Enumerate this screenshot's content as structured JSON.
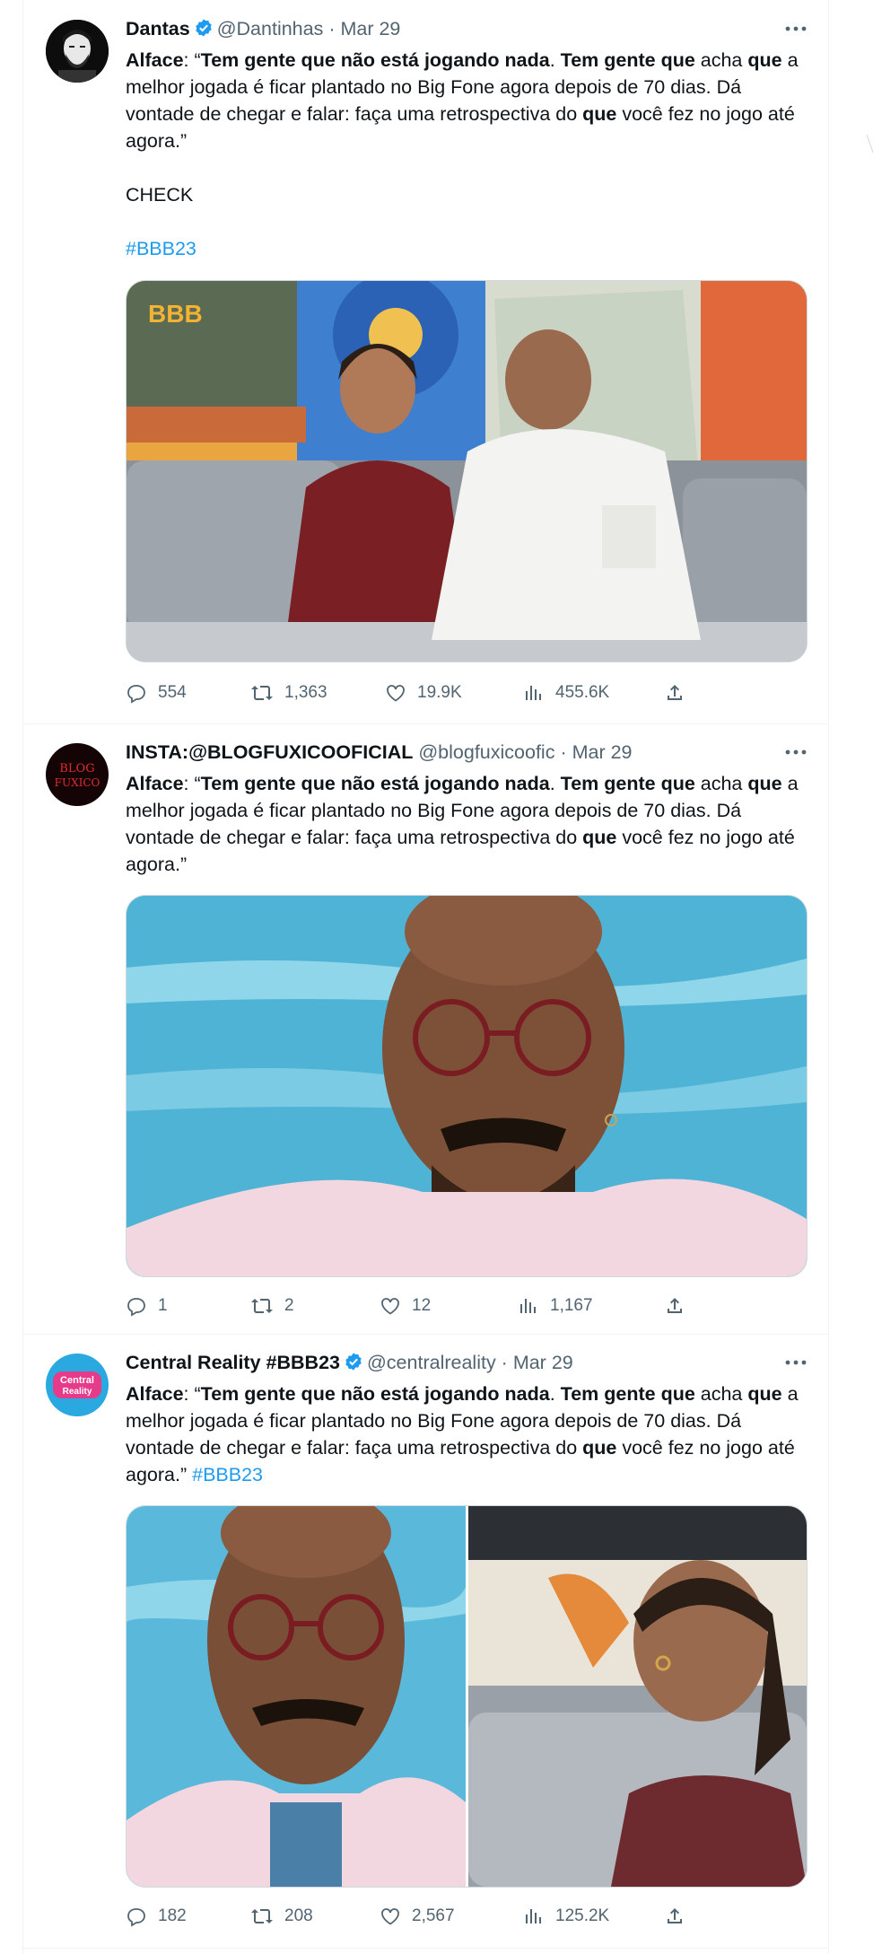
{
  "tweets": [
    {
      "name": "Dantas",
      "verified": true,
      "handle": "@Dantinhas",
      "date": "Mar 29",
      "text": {
        "p1": "Alface",
        "p2": ": “",
        "p3": "Tem gente que não está jogando nada",
        "p4": ". ",
        "p5": "Tem gente que",
        "p6": " acha ",
        "p7": "que",
        "p8": " a melhor jogada é ficar plantado no Big Fone agora depois de 70 dias. Dá vontade de chegar e falar: faça uma retrospectiva do ",
        "p9": "que",
        "p10": " você fez no jogo até agora.”"
      },
      "extra_line": "CHECK",
      "hashtag": "#BBB23",
      "media_logo": "BBB",
      "stats": {
        "replies": "554",
        "retweets": "1,363",
        "likes": "19.9K",
        "views": "455.6K"
      }
    },
    {
      "name": "INSTA:@BLOGFUXICOOFICIAL",
      "verified": false,
      "handle": "@blogfuxicoofic",
      "date": "Mar 29",
      "avatar_text": [
        "BLOG",
        "FUXICO"
      ],
      "text": {
        "p1": "Alface",
        "p2": ": “",
        "p3": "Tem gente que não está jogando nada",
        "p4": ". ",
        "p5": "Tem gente que",
        "p6": " acha ",
        "p7": "que",
        "p8": " a melhor jogada é ficar plantado no Big Fone agora depois de 70 dias. Dá vontade de chegar e falar: faça uma retrospectiva do ",
        "p9": "que",
        "p10": " você fez no jogo até agora.”"
      },
      "stats": {
        "replies": "1",
        "retweets": "2",
        "likes": "12",
        "views": "1,167"
      }
    },
    {
      "name": "Central Reality #BBB23",
      "verified": true,
      "handle": "@centralreality",
      "date": "Mar 29",
      "avatar_text": [
        "Central",
        "Reality"
      ],
      "text": {
        "p1": "Alface",
        "p2": ": “",
        "p3": "Tem gente que não está jogando nada",
        "p4": ". ",
        "p5": "Tem gente que",
        "p6": " acha ",
        "p7": "que",
        "p8": " a melhor jogada é ficar plantado no Big Fone agora depois de 70 dias. Dá vontade de chegar e falar: faça uma retrospectiva do ",
        "p9": "que",
        "p10": " você fez no jogo até agora.” "
      },
      "hashtag": "#BBB23",
      "stats": {
        "replies": "182",
        "retweets": "208",
        "likes": "2,567",
        "views": "125.2K"
      }
    }
  ],
  "colors": {
    "verified": "#1d9bf0",
    "link": "#1d9bf0",
    "muted": "#536471",
    "border": "#eff3f4"
  },
  "icons": [
    "verified-badge-icon",
    "more-icon",
    "reply-icon",
    "retweet-icon",
    "like-icon",
    "views-icon",
    "share-icon"
  ]
}
